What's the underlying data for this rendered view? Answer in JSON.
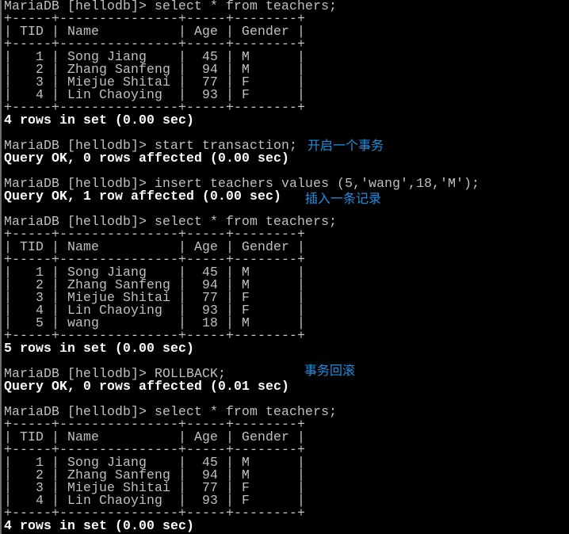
{
  "terminal": {
    "prompt": "MariaDB [hellodb]> ",
    "blocks": {
      "select1": {
        "command": "select * from teachers;",
        "border": "+-----+---------------+-----+--------+",
        "header": "| TID | Name          | Age | Gender |",
        "rows": [
          "|   1 | Song Jiang    |  45 | M      |",
          "|   2 | Zhang Sanfeng |  94 | M      |",
          "|   3 | Miejue Shitai |  77 | F      |",
          "|   4 | Lin Chaoying  |  93 | F      |"
        ],
        "result": "4 rows in set (0.00 sec)"
      },
      "start": {
        "command": "start transaction;",
        "result": "Query OK, 0 rows affected (0.00 sec)",
        "annotation": "开启一个事务"
      },
      "insert": {
        "command": "insert teachers values (5,'wang',18,'M');",
        "result": "Query OK, 1 row affected (0.00 sec)",
        "annotation": "插入一条记录"
      },
      "select2": {
        "command": "select * from teachers;",
        "border": "+-----+---------------+-----+--------+",
        "header": "| TID | Name          | Age | Gender |",
        "rows": [
          "|   1 | Song Jiang    |  45 | M      |",
          "|   2 | Zhang Sanfeng |  94 | M      |",
          "|   3 | Miejue Shitai |  77 | F      |",
          "|   4 | Lin Chaoying  |  93 | F      |",
          "|   5 | wang          |  18 | M      |"
        ],
        "result": "5 rows in set (0.00 sec)"
      },
      "rollback": {
        "command": "ROLLBACK;",
        "result": "Query OK, 0 rows affected (0.01 sec)",
        "annotation": "事务回滚"
      },
      "select3": {
        "command": "select * from teachers;",
        "border": "+-----+---------------+-----+--------+",
        "header": "| TID | Name          | Age | Gender |",
        "rows": [
          "|   1 | Song Jiang    |  45 | M      |",
          "|   2 | Zhang Sanfeng |  94 | M      |",
          "|   3 | Miejue Shitai |  77 | F      |",
          "|   4 | Lin Chaoying  |  93 | F      |"
        ],
        "result": "4 rows in set (0.00 sec)"
      }
    }
  },
  "colors": {
    "background": "#000000",
    "text": "#c0c0c0",
    "bold_text": "#ffffff",
    "annotation": "#1e8fe0"
  }
}
